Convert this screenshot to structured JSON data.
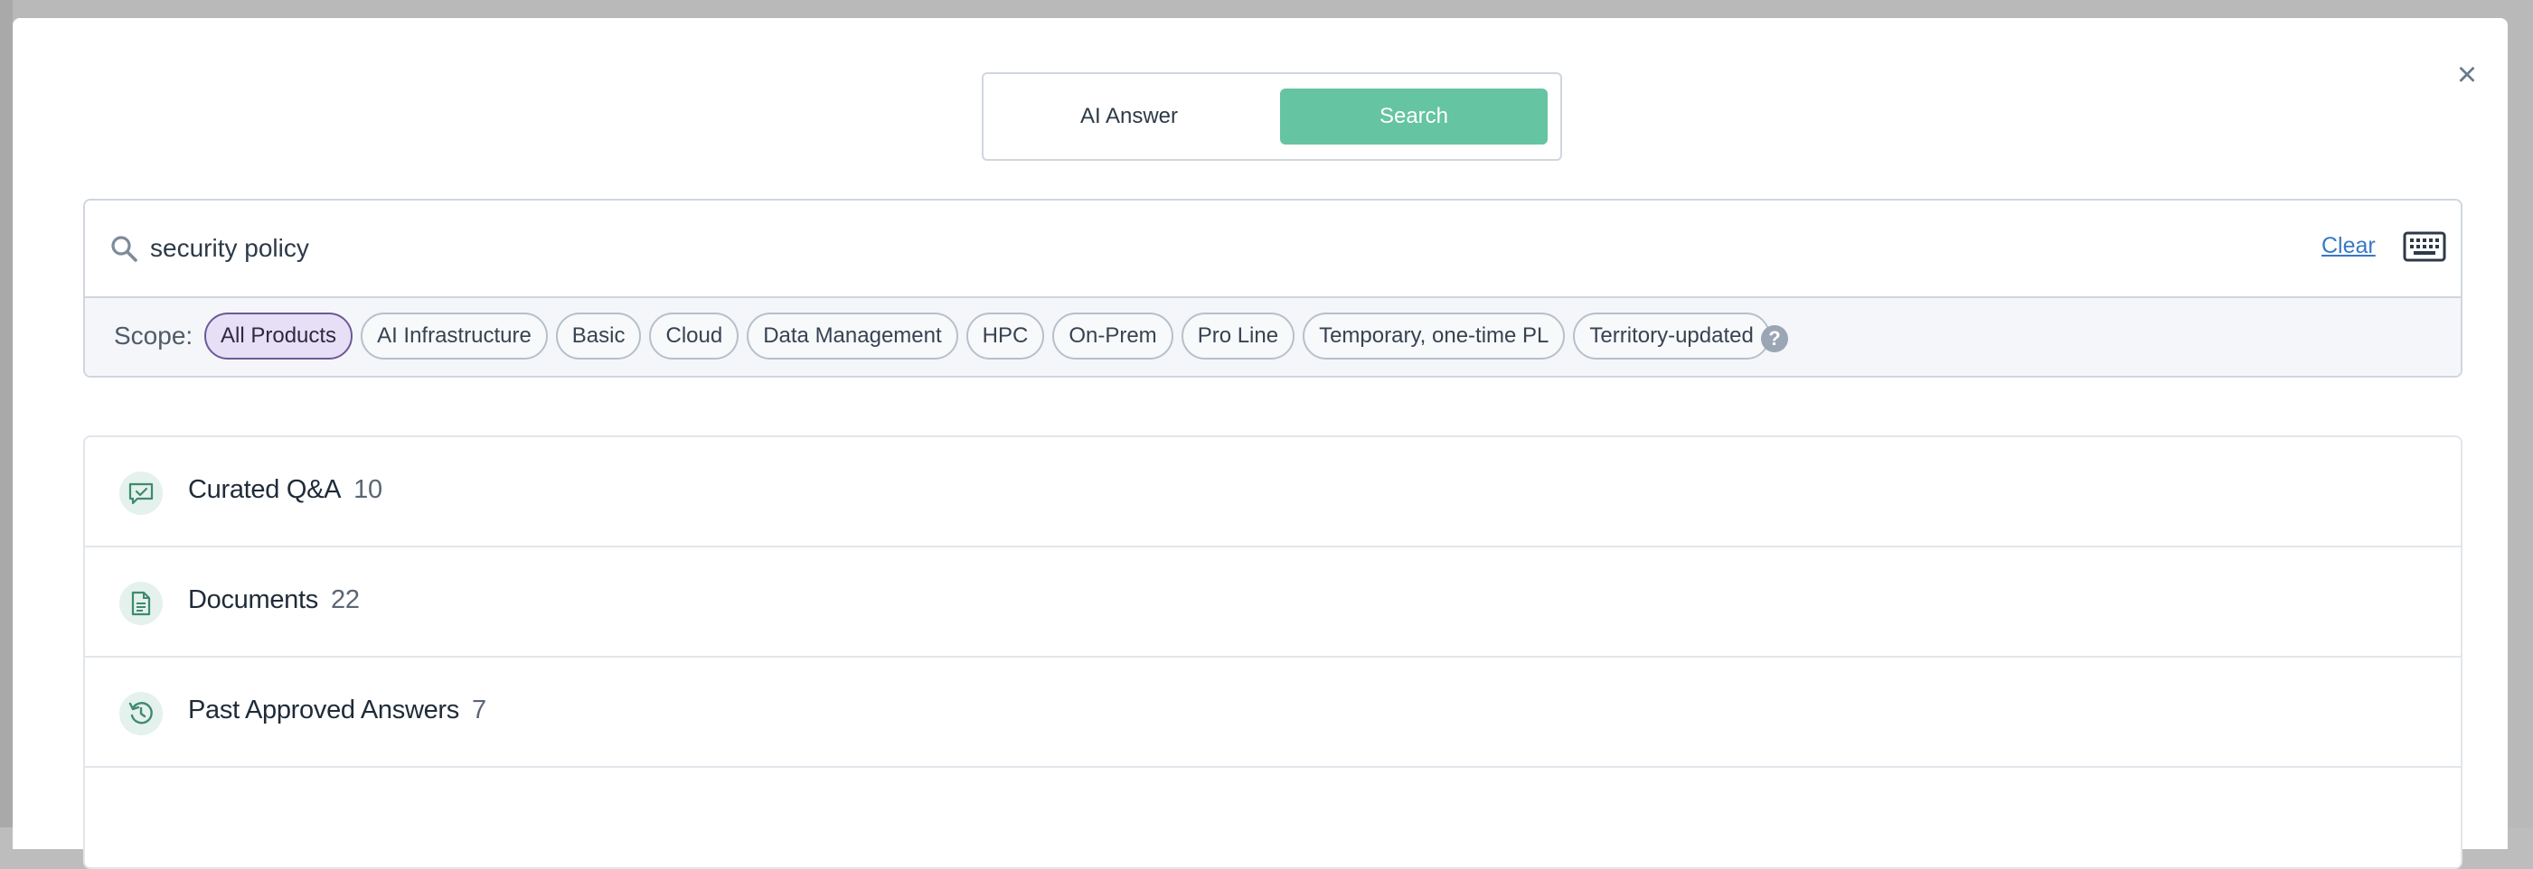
{
  "toggle": {
    "ai_answer": "AI Answer",
    "search": "Search"
  },
  "search": {
    "value": "security policy",
    "clear_label": "Clear"
  },
  "scope": {
    "label": "Scope:",
    "chips": [
      {
        "label": "All Products",
        "active": true
      },
      {
        "label": "AI Infrastructure",
        "active": false
      },
      {
        "label": "Basic",
        "active": false
      },
      {
        "label": "Cloud",
        "active": false
      },
      {
        "label": "Data Management",
        "active": false
      },
      {
        "label": "HPC",
        "active": false
      },
      {
        "label": "On-Prem",
        "active": false
      },
      {
        "label": "Pro Line",
        "active": false
      },
      {
        "label": "Temporary, one-time PL",
        "active": false
      },
      {
        "label": "Territory-updated",
        "active": false
      }
    ],
    "help_symbol": "?"
  },
  "results": [
    {
      "label": "Curated Q&A",
      "count": "10",
      "icon": "chat-check-icon"
    },
    {
      "label": "Documents",
      "count": "22",
      "icon": "document-icon"
    },
    {
      "label": "Past Approved Answers",
      "count": "7",
      "icon": "history-icon"
    }
  ],
  "colors": {
    "accent": "#65c4a1",
    "link": "#3979c4",
    "icon_green": "#3d8b6e",
    "active_chip_bg": "#e6dff6"
  }
}
